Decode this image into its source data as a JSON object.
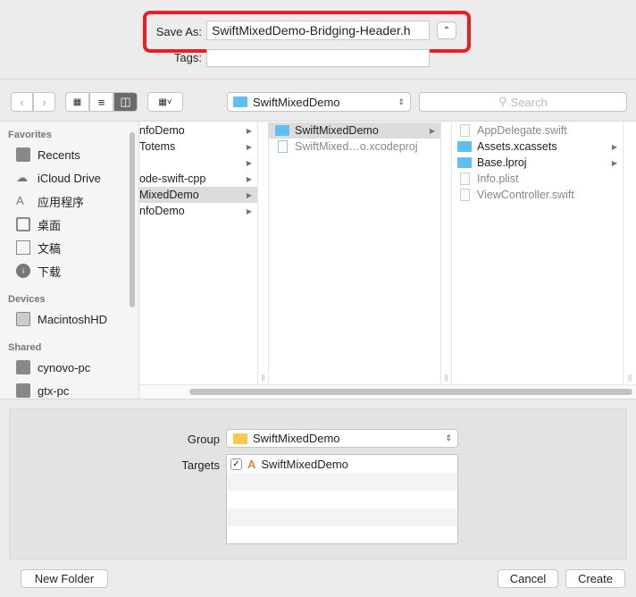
{
  "save_as": {
    "label": "Save As:",
    "value": "SwiftMixedDemo-Bridging-Header.h",
    "tags_label": "Tags:",
    "tags_value": ""
  },
  "toolbar": {
    "path": "SwiftMixedDemo",
    "search_placeholder": "Search"
  },
  "sidebar": {
    "favorites_header": "Favorites",
    "favorites": [
      {
        "label": "Recents",
        "icon": "recents-icon"
      },
      {
        "label": "iCloud Drive",
        "icon": "cloud-icon"
      },
      {
        "label": "应用程序",
        "icon": "applications-icon"
      },
      {
        "label": "桌面",
        "icon": "desktop-icon"
      },
      {
        "label": "文稿",
        "icon": "documents-icon"
      },
      {
        "label": "下载",
        "icon": "download-icon"
      }
    ],
    "devices_header": "Devices",
    "devices": [
      {
        "label": "MacintoshHD",
        "icon": "disk-icon"
      }
    ],
    "shared_header": "Shared",
    "shared": [
      {
        "label": "cynovo-pc",
        "icon": "monitor-icon"
      },
      {
        "label": "gtx-pc",
        "icon": "monitor-icon"
      }
    ]
  },
  "columns": [
    {
      "items": [
        {
          "label": "nfoDemo"
        },
        {
          "label": "Totems"
        },
        {
          "label": ""
        },
        {
          "label": "ode-swift-cpp"
        },
        {
          "label": "MixedDemo",
          "selected": true
        },
        {
          "label": "nfoDemo"
        }
      ]
    },
    {
      "items": [
        {
          "label": "SwiftMixedDemo",
          "type": "folder",
          "selected": true
        },
        {
          "label": "SwiftMixed…o.xcodeproj",
          "type": "xcodeproj"
        }
      ]
    },
    {
      "items": [
        {
          "label": "AppDelegate.swift",
          "type": "swift"
        },
        {
          "label": "Assets.xcassets",
          "type": "folder"
        },
        {
          "label": "Base.lproj",
          "type": "folder"
        },
        {
          "label": "Info.plist",
          "type": "plist"
        },
        {
          "label": "ViewController.swift",
          "type": "swift"
        }
      ]
    }
  ],
  "options": {
    "group_label": "Group",
    "group_value": "SwiftMixedDemo",
    "targets_label": "Targets",
    "targets": [
      {
        "label": "SwiftMixedDemo",
        "checked": true
      }
    ]
  },
  "buttons": {
    "new_folder": "New Folder",
    "cancel": "Cancel",
    "create": "Create"
  },
  "colors": {
    "highlight": "#ee1c24",
    "folder": "#5ec0f0",
    "group_folder": "#fbc94a"
  }
}
